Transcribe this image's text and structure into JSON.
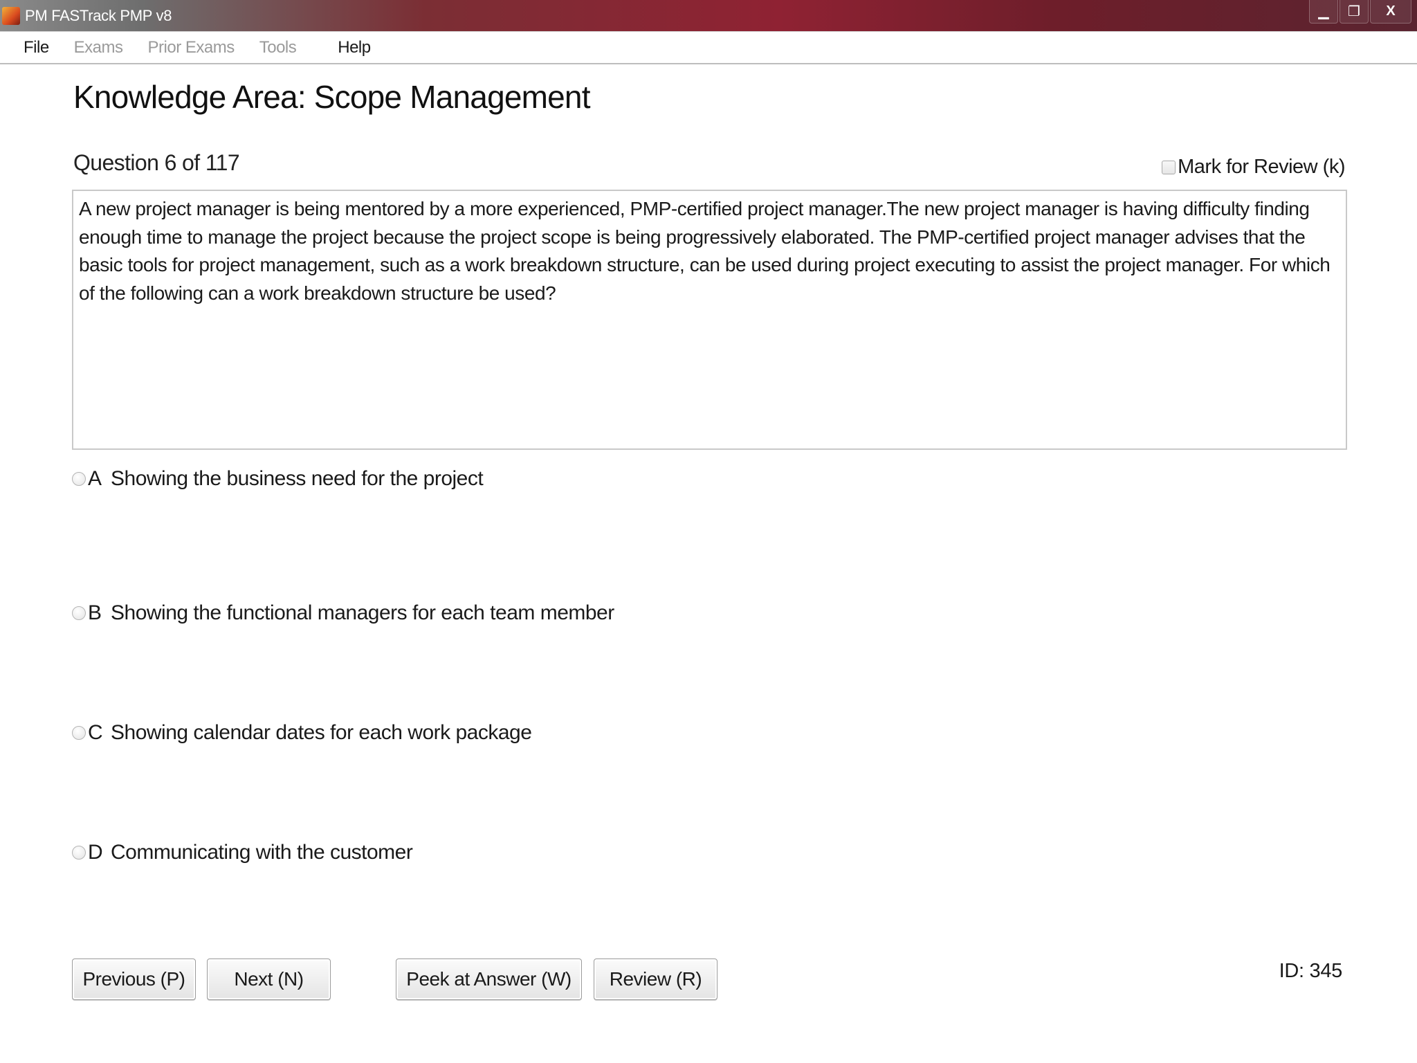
{
  "window": {
    "title": "PM FASTrack PMP v8",
    "minimize_glyph": "▁",
    "restore_glyph": "❐",
    "close_glyph": "X"
  },
  "menu": {
    "items": [
      {
        "label": "File",
        "enabled": true
      },
      {
        "label": "Exams",
        "enabled": false
      },
      {
        "label": "Prior Exams",
        "enabled": false
      },
      {
        "label": "Tools",
        "enabled": false
      },
      {
        "label": "Help",
        "enabled": true
      }
    ]
  },
  "exam": {
    "knowledge_area": "Knowledge Area: Scope Management",
    "question_counter": "Question 6 of 117",
    "mark_for_review_label": "Mark for Review (k)",
    "mark_for_review_checked": false,
    "question_text": "A new project manager is being mentored by a more experienced, PMP-certified project manager.The new project manager is having difficulty finding enough time to manage the project because the project scope is being progressively elaborated. The PMP-certified project manager advises that the basic tools for project management, such as a work breakdown structure, can be used during project executing to assist the project manager. For which of the following can a work breakdown structure be used?",
    "options": [
      {
        "letter": "A",
        "text": "Showing the business need for the project",
        "selected": false
      },
      {
        "letter": "B",
        "text": "Showing the functional managers for each team member",
        "selected": false
      },
      {
        "letter": "C",
        "text": "Showing calendar dates for each work package",
        "selected": false
      },
      {
        "letter": "D",
        "text": "Communicating with the customer",
        "selected": false
      }
    ],
    "id_label": "ID: 345"
  },
  "buttons": {
    "previous": "Previous (P)",
    "next": "Next (N)",
    "peek": "Peek at Answer (W)",
    "review": "Review (R)"
  }
}
